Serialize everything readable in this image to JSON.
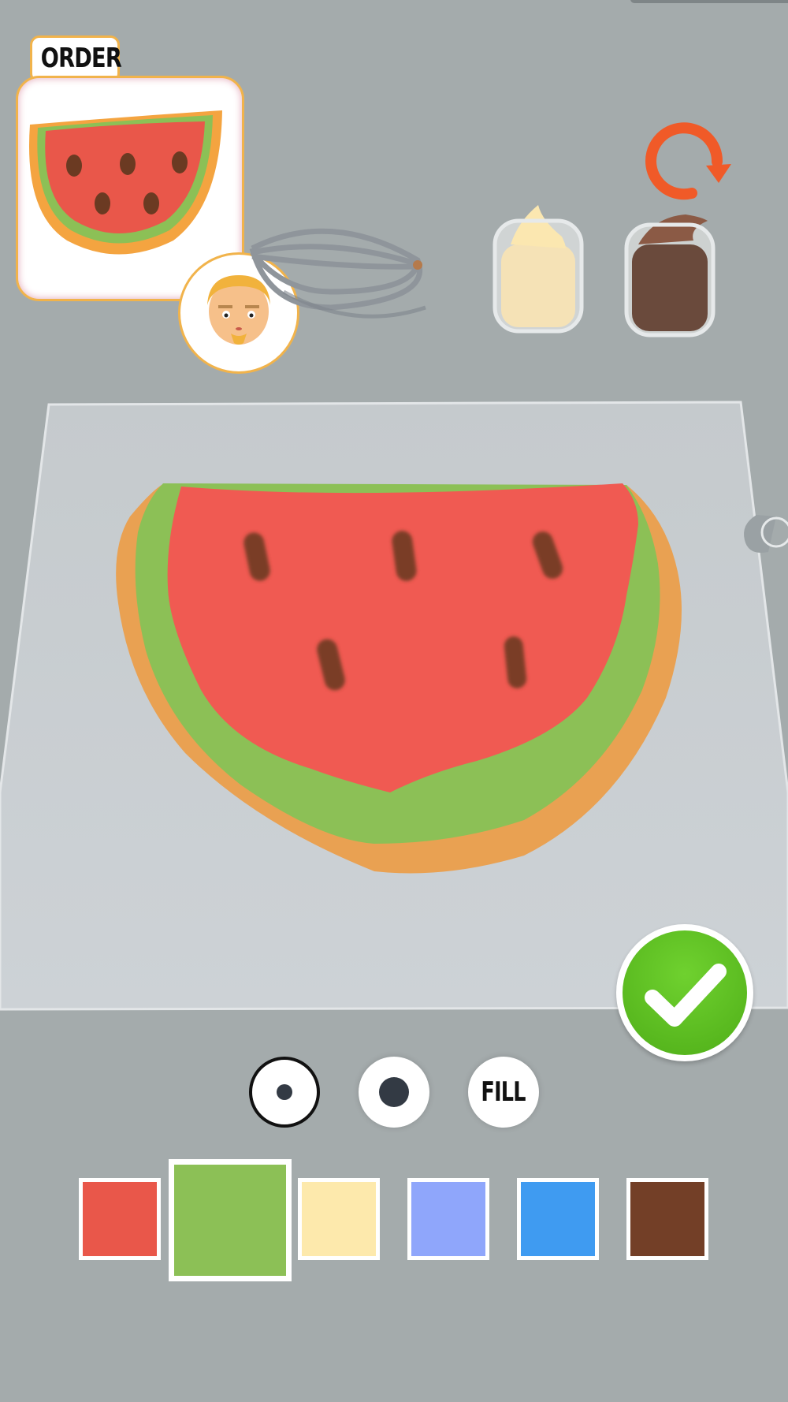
{
  "order": {
    "label": "ORDER"
  },
  "brushes": {
    "small": {
      "selected": true
    },
    "large": {
      "selected": false
    },
    "fill_label": "FILL"
  },
  "palette": {
    "selected_index": 1,
    "colors": [
      "#e9574a",
      "#8cc056",
      "#fde9ac",
      "#8fa6fb",
      "#3f9bf1",
      "#733f27"
    ]
  },
  "colors": {
    "background": "#a4abac",
    "accent_orange": "#f1b34b",
    "confirm_green": "#5cc021",
    "reset_orange": "#f05a28"
  }
}
